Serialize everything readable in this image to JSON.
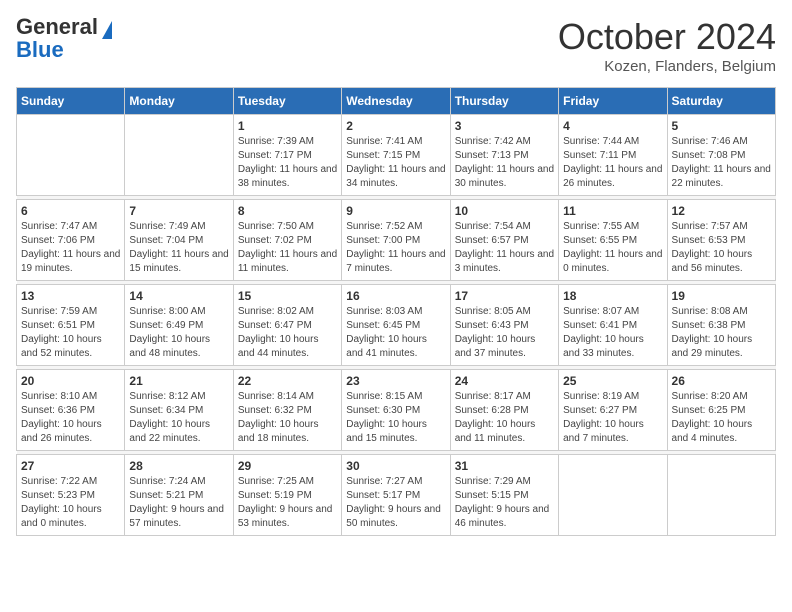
{
  "logo": {
    "general": "General",
    "blue": "Blue"
  },
  "title": "October 2024",
  "location": "Kozen, Flanders, Belgium",
  "days_of_week": [
    "Sunday",
    "Monday",
    "Tuesday",
    "Wednesday",
    "Thursday",
    "Friday",
    "Saturday"
  ],
  "weeks": [
    [
      {
        "day": "",
        "sunrise": "",
        "sunset": "",
        "daylight": ""
      },
      {
        "day": "",
        "sunrise": "",
        "sunset": "",
        "daylight": ""
      },
      {
        "day": "1",
        "sunrise": "Sunrise: 7:39 AM",
        "sunset": "Sunset: 7:17 PM",
        "daylight": "Daylight: 11 hours and 38 minutes."
      },
      {
        "day": "2",
        "sunrise": "Sunrise: 7:41 AM",
        "sunset": "Sunset: 7:15 PM",
        "daylight": "Daylight: 11 hours and 34 minutes."
      },
      {
        "day": "3",
        "sunrise": "Sunrise: 7:42 AM",
        "sunset": "Sunset: 7:13 PM",
        "daylight": "Daylight: 11 hours and 30 minutes."
      },
      {
        "day": "4",
        "sunrise": "Sunrise: 7:44 AM",
        "sunset": "Sunset: 7:11 PM",
        "daylight": "Daylight: 11 hours and 26 minutes."
      },
      {
        "day": "5",
        "sunrise": "Sunrise: 7:46 AM",
        "sunset": "Sunset: 7:08 PM",
        "daylight": "Daylight: 11 hours and 22 minutes."
      }
    ],
    [
      {
        "day": "6",
        "sunrise": "Sunrise: 7:47 AM",
        "sunset": "Sunset: 7:06 PM",
        "daylight": "Daylight: 11 hours and 19 minutes."
      },
      {
        "day": "7",
        "sunrise": "Sunrise: 7:49 AM",
        "sunset": "Sunset: 7:04 PM",
        "daylight": "Daylight: 11 hours and 15 minutes."
      },
      {
        "day": "8",
        "sunrise": "Sunrise: 7:50 AM",
        "sunset": "Sunset: 7:02 PM",
        "daylight": "Daylight: 11 hours and 11 minutes."
      },
      {
        "day": "9",
        "sunrise": "Sunrise: 7:52 AM",
        "sunset": "Sunset: 7:00 PM",
        "daylight": "Daylight: 11 hours and 7 minutes."
      },
      {
        "day": "10",
        "sunrise": "Sunrise: 7:54 AM",
        "sunset": "Sunset: 6:57 PM",
        "daylight": "Daylight: 11 hours and 3 minutes."
      },
      {
        "day": "11",
        "sunrise": "Sunrise: 7:55 AM",
        "sunset": "Sunset: 6:55 PM",
        "daylight": "Daylight: 11 hours and 0 minutes."
      },
      {
        "day": "12",
        "sunrise": "Sunrise: 7:57 AM",
        "sunset": "Sunset: 6:53 PM",
        "daylight": "Daylight: 10 hours and 56 minutes."
      }
    ],
    [
      {
        "day": "13",
        "sunrise": "Sunrise: 7:59 AM",
        "sunset": "Sunset: 6:51 PM",
        "daylight": "Daylight: 10 hours and 52 minutes."
      },
      {
        "day": "14",
        "sunrise": "Sunrise: 8:00 AM",
        "sunset": "Sunset: 6:49 PM",
        "daylight": "Daylight: 10 hours and 48 minutes."
      },
      {
        "day": "15",
        "sunrise": "Sunrise: 8:02 AM",
        "sunset": "Sunset: 6:47 PM",
        "daylight": "Daylight: 10 hours and 44 minutes."
      },
      {
        "day": "16",
        "sunrise": "Sunrise: 8:03 AM",
        "sunset": "Sunset: 6:45 PM",
        "daylight": "Daylight: 10 hours and 41 minutes."
      },
      {
        "day": "17",
        "sunrise": "Sunrise: 8:05 AM",
        "sunset": "Sunset: 6:43 PM",
        "daylight": "Daylight: 10 hours and 37 minutes."
      },
      {
        "day": "18",
        "sunrise": "Sunrise: 8:07 AM",
        "sunset": "Sunset: 6:41 PM",
        "daylight": "Daylight: 10 hours and 33 minutes."
      },
      {
        "day": "19",
        "sunrise": "Sunrise: 8:08 AM",
        "sunset": "Sunset: 6:38 PM",
        "daylight": "Daylight: 10 hours and 29 minutes."
      }
    ],
    [
      {
        "day": "20",
        "sunrise": "Sunrise: 8:10 AM",
        "sunset": "Sunset: 6:36 PM",
        "daylight": "Daylight: 10 hours and 26 minutes."
      },
      {
        "day": "21",
        "sunrise": "Sunrise: 8:12 AM",
        "sunset": "Sunset: 6:34 PM",
        "daylight": "Daylight: 10 hours and 22 minutes."
      },
      {
        "day": "22",
        "sunrise": "Sunrise: 8:14 AM",
        "sunset": "Sunset: 6:32 PM",
        "daylight": "Daylight: 10 hours and 18 minutes."
      },
      {
        "day": "23",
        "sunrise": "Sunrise: 8:15 AM",
        "sunset": "Sunset: 6:30 PM",
        "daylight": "Daylight: 10 hours and 15 minutes."
      },
      {
        "day": "24",
        "sunrise": "Sunrise: 8:17 AM",
        "sunset": "Sunset: 6:28 PM",
        "daylight": "Daylight: 10 hours and 11 minutes."
      },
      {
        "day": "25",
        "sunrise": "Sunrise: 8:19 AM",
        "sunset": "Sunset: 6:27 PM",
        "daylight": "Daylight: 10 hours and 7 minutes."
      },
      {
        "day": "26",
        "sunrise": "Sunrise: 8:20 AM",
        "sunset": "Sunset: 6:25 PM",
        "daylight": "Daylight: 10 hours and 4 minutes."
      }
    ],
    [
      {
        "day": "27",
        "sunrise": "Sunrise: 7:22 AM",
        "sunset": "Sunset: 5:23 PM",
        "daylight": "Daylight: 10 hours and 0 minutes."
      },
      {
        "day": "28",
        "sunrise": "Sunrise: 7:24 AM",
        "sunset": "Sunset: 5:21 PM",
        "daylight": "Daylight: 9 hours and 57 minutes."
      },
      {
        "day": "29",
        "sunrise": "Sunrise: 7:25 AM",
        "sunset": "Sunset: 5:19 PM",
        "daylight": "Daylight: 9 hours and 53 minutes."
      },
      {
        "day": "30",
        "sunrise": "Sunrise: 7:27 AM",
        "sunset": "Sunset: 5:17 PM",
        "daylight": "Daylight: 9 hours and 50 minutes."
      },
      {
        "day": "31",
        "sunrise": "Sunrise: 7:29 AM",
        "sunset": "Sunset: 5:15 PM",
        "daylight": "Daylight: 9 hours and 46 minutes."
      },
      {
        "day": "",
        "sunrise": "",
        "sunset": "",
        "daylight": ""
      },
      {
        "day": "",
        "sunrise": "",
        "sunset": "",
        "daylight": ""
      }
    ]
  ]
}
